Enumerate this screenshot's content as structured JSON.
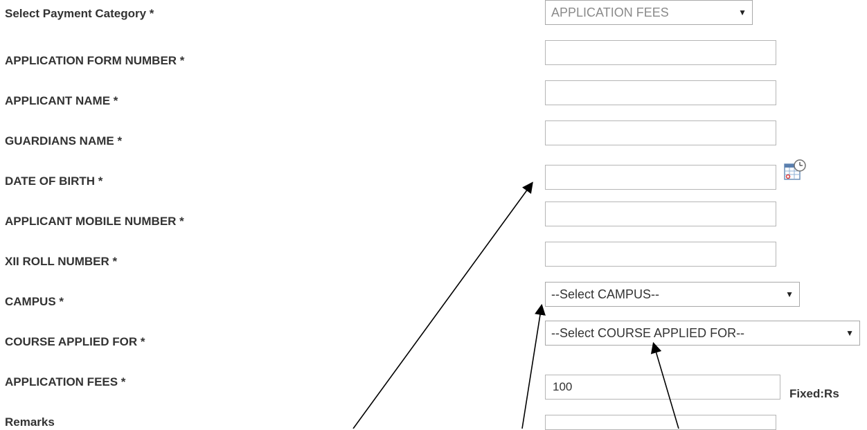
{
  "form": {
    "payment_category": {
      "label": "Select Payment Category *",
      "selected": "APPLICATION FEES"
    },
    "application_form_number": {
      "label": "APPLICATION FORM NUMBER *",
      "value": ""
    },
    "applicant_name": {
      "label": "APPLICANT NAME *",
      "value": ""
    },
    "guardians_name": {
      "label": "GUARDIANS NAME *",
      "value": ""
    },
    "date_of_birth": {
      "label": "DATE OF BIRTH *",
      "value": "",
      "icon": "calendar-clock-icon"
    },
    "applicant_mobile_number": {
      "label": "APPLICANT MOBILE NUMBER *",
      "value": ""
    },
    "xii_roll_number": {
      "label": "XII ROLL NUMBER *",
      "value": ""
    },
    "campus": {
      "label": "CAMPUS *",
      "selected": "--Select CAMPUS--"
    },
    "course_applied_for": {
      "label": "COURSE APPLIED FOR *",
      "selected": "--Select COURSE APPLIED FOR--"
    },
    "application_fees": {
      "label": "APPLICATION FEES *",
      "value": "100",
      "note": "Fixed:Rs"
    },
    "remarks": {
      "label": "Remarks",
      "value": ""
    }
  },
  "colors": {
    "label_text": "#333333",
    "input_border": "#b5b5b5",
    "annotation_arrow": "#000000"
  }
}
